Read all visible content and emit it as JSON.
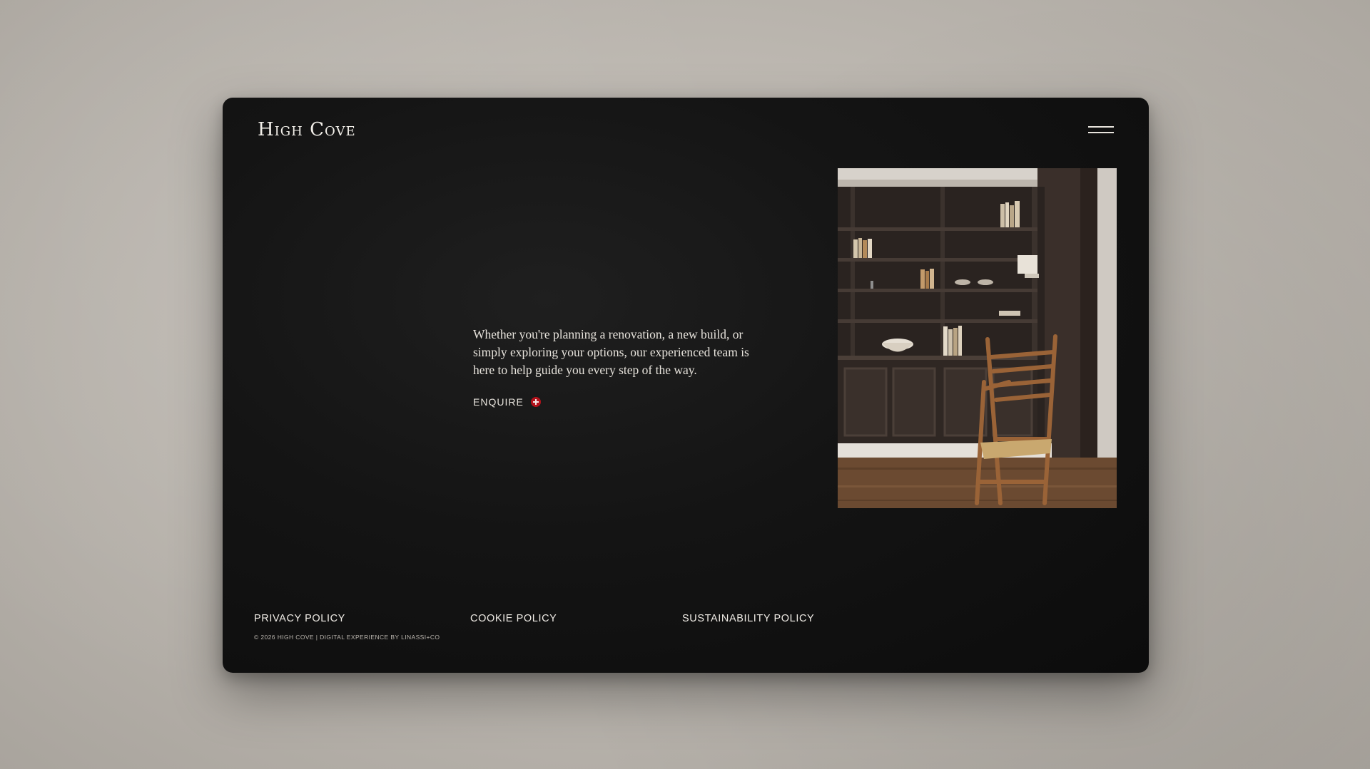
{
  "brand": {
    "logo_text": "High Cove"
  },
  "header": {
    "menu_icon": "hamburger-menu-icon"
  },
  "intro": {
    "text": "Whether you're planning a renovation, a new build, or simply exploring your options, our experienced team is here to help guide you every step of the way.",
    "cta_label": "ENQUIRE",
    "cta_icon": "plus-circle-icon",
    "cta_icon_color": "#b3121b"
  },
  "hero_image": {
    "subject": "dark built-in bookshelves with cabinets and a rush-seat wooden chair"
  },
  "footer": {
    "links": [
      {
        "label": "PRIVACY POLICY"
      },
      {
        "label": "COOKIE POLICY"
      },
      {
        "label": "SUSTAINABILITY POLICY"
      }
    ],
    "copyright": "© 2026 HIGH COVE | DIGITAL EXPERIENCE BY LINASSI+CO"
  },
  "colors": {
    "page_background": "#c2bdb6",
    "panel_background": "#141414",
    "text_light": "#e8e4dd",
    "accent": "#b3121b"
  }
}
